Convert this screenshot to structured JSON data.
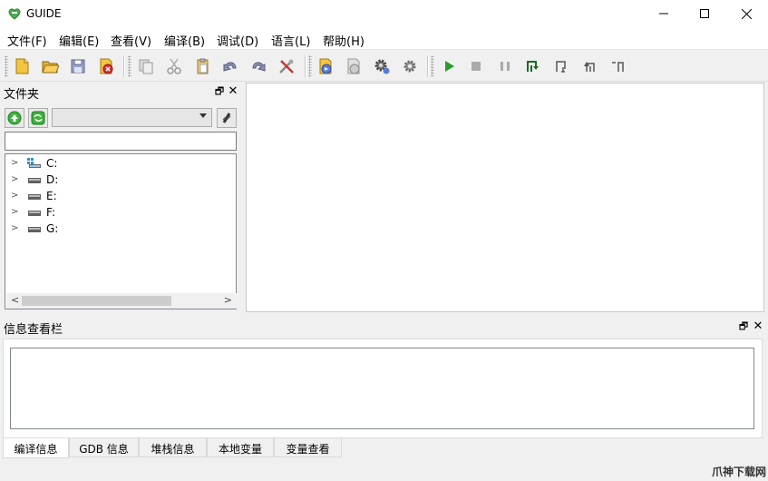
{
  "window": {
    "title": "GUIDE"
  },
  "menu": [
    "文件(F)",
    "编辑(E)",
    "查看(V)",
    "编译(B)",
    "调试(D)",
    "语言(L)",
    "帮助(H)"
  ],
  "toolbar": {
    "icons": [
      "new-file-icon",
      "open-folder-icon",
      "save-icon",
      "close-file-icon",
      "copy-icon",
      "cut-icon",
      "paste-icon",
      "undo-icon",
      "redo-icon",
      "tools-icon",
      "compile-icon",
      "build-icon",
      "settings-gear-icon",
      "settings-gear2-icon",
      "run-icon",
      "stop-icon",
      "pause-icon",
      "step-into-icon",
      "step-over-icon",
      "step-out-icon",
      "run-to-cursor-icon"
    ]
  },
  "folder_panel": {
    "title": "文件夹",
    "path_value": "",
    "combo_value": "",
    "drives": [
      "C:",
      "D:",
      "E:",
      "F:",
      "G:"
    ]
  },
  "info_panel": {
    "title": "信息查看栏",
    "tabs": [
      "编译信息",
      "GDB 信息",
      "堆栈信息",
      "本地变量",
      "变量查看"
    ]
  },
  "watermark": "爪神下载网",
  "colors": {
    "run": "#2a9d2a",
    "step": "#1e6b1e",
    "accent": "#d4a017"
  }
}
